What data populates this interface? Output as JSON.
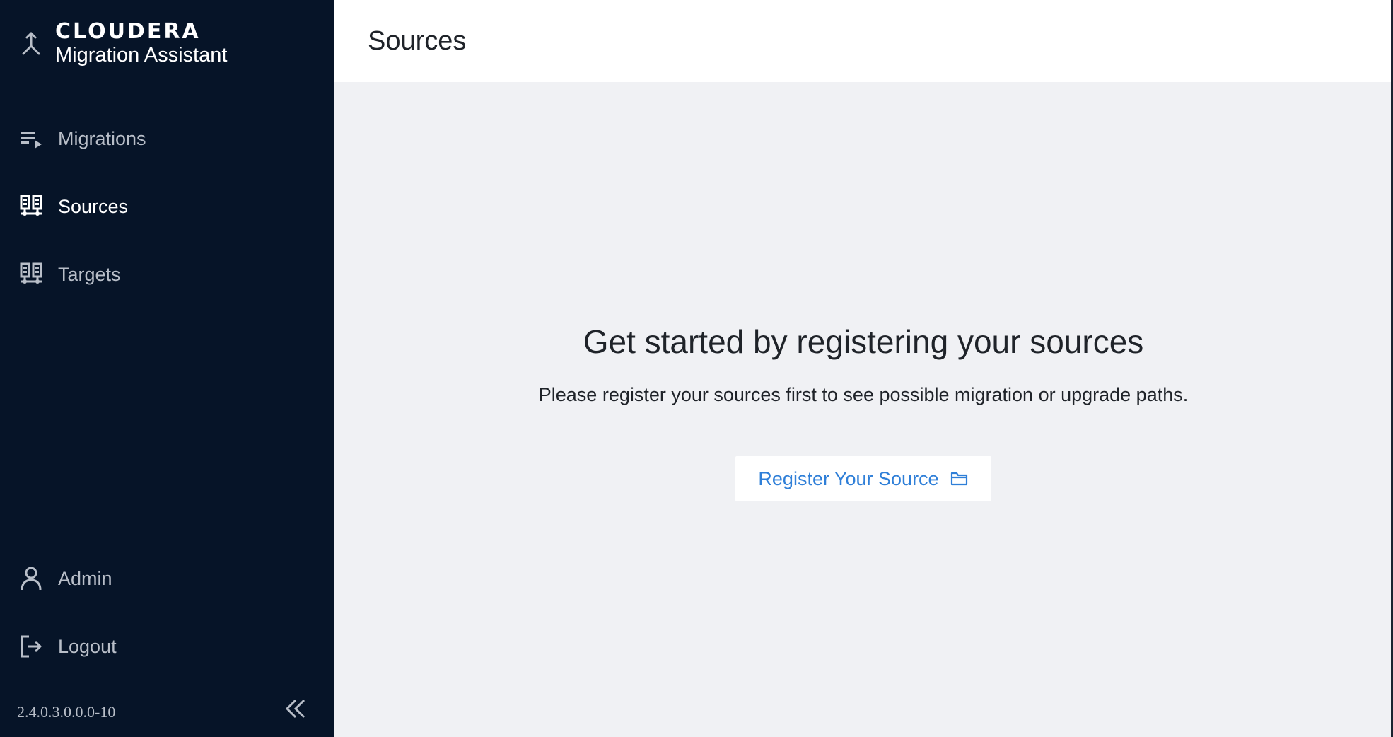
{
  "brand": {
    "name": "CLOUDERA",
    "subtitle": "Migration Assistant",
    "icon": "merge-arrow-icon"
  },
  "sidebar": {
    "items": [
      {
        "label": "Migrations",
        "icon": "playlist-play-icon",
        "active": false
      },
      {
        "label": "Sources",
        "icon": "cluster-icon",
        "active": true
      },
      {
        "label": "Targets",
        "icon": "cluster-icon",
        "active": false
      }
    ],
    "bottom_items": [
      {
        "label": "Admin",
        "icon": "user-icon"
      },
      {
        "label": "Logout",
        "icon": "logout-icon"
      }
    ],
    "version": "2.4.0.3.0.0.0-10",
    "collapse_icon": "double-chevron-left-icon"
  },
  "header": {
    "title": "Sources"
  },
  "empty_state": {
    "title": "Get started by registering your sources",
    "description": "Please register your sources first to see possible migration or upgrade paths.",
    "button_label": "Register Your Source",
    "button_icon": "folder-icon"
  },
  "colors": {
    "sidebar_bg": "#061428",
    "main_bg": "#f0f1f4",
    "accent": "#2f7fd8",
    "active_text": "#ffffff",
    "inactive_text": "#b8bec8"
  }
}
